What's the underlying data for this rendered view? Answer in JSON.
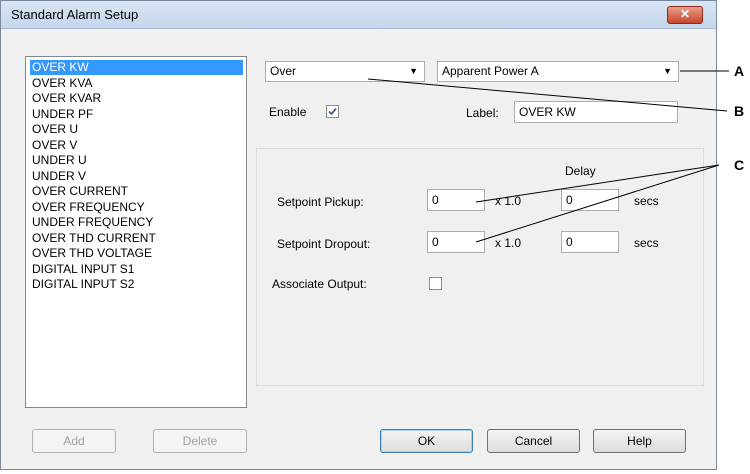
{
  "window": {
    "title": "Standard Alarm Setup",
    "close_glyph": "✕"
  },
  "alarm_list": {
    "items": [
      "OVER KW",
      "OVER KVA",
      "OVER KVAR",
      "UNDER PF",
      "OVER U",
      "OVER V",
      "UNDER U",
      "UNDER V",
      "OVER CURRENT",
      "OVER FREQUENCY",
      "UNDER FREQUENCY",
      "OVER THD CURRENT",
      "OVER THD VOLTAGE",
      "DIGITAL INPUT S1",
      "DIGITAL INPUT S2"
    ],
    "selected_index": 0
  },
  "list_buttons": {
    "add": "Add",
    "delete": "Delete"
  },
  "condition_combo": {
    "value": "Over"
  },
  "quantity_combo": {
    "value": "Apparent Power A"
  },
  "enable": {
    "label": "Enable",
    "checked": true
  },
  "label_field": {
    "label": "Label:",
    "value": "OVER KW"
  },
  "setpoints": {
    "delay_header": "Delay",
    "pickup": {
      "label": "Setpoint Pickup:",
      "value": "0",
      "multiplier": "x 1.0",
      "delay": "0",
      "unit": "secs"
    },
    "dropout": {
      "label": "Setpoint Dropout:",
      "value": "0",
      "multiplier": "x 1.0",
      "delay": "0",
      "unit": "secs"
    },
    "associate_output": {
      "label": "Associate Output:",
      "checked": false
    }
  },
  "dialog_buttons": {
    "ok": "OK",
    "cancel": "Cancel",
    "help": "Help"
  },
  "callouts": {
    "a": "A",
    "b": "B",
    "c": "C"
  }
}
